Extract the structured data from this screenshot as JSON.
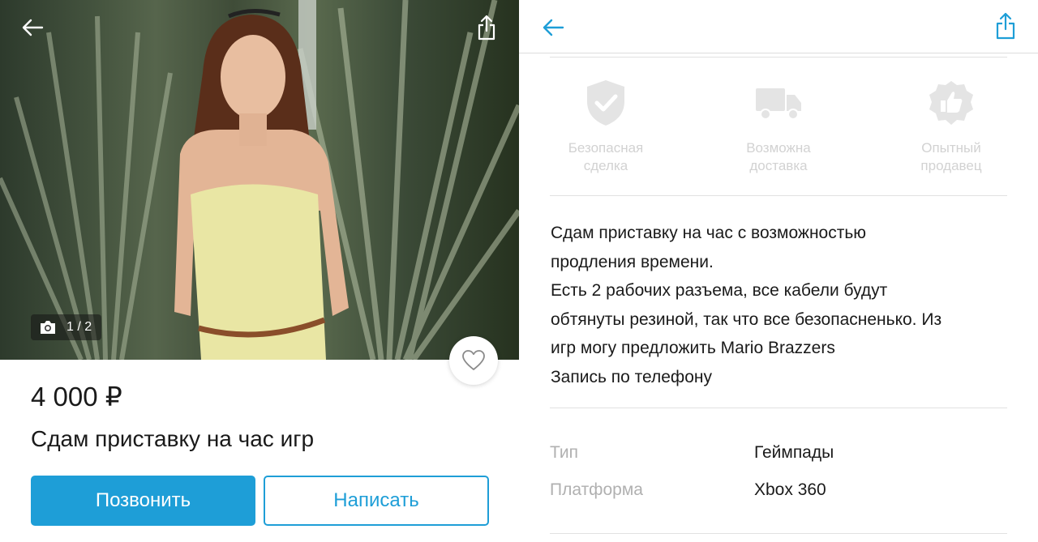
{
  "listing": {
    "photo_counter": "1 / 2",
    "price": "4 000 ₽",
    "title": "Сдам приставку на час игр",
    "call_button": "Позвонить",
    "write_button": "Написать"
  },
  "features": [
    {
      "icon": "shield-check-icon",
      "label_line1": "Безопасная",
      "label_line2": "сделка"
    },
    {
      "icon": "truck-icon",
      "label_line1": "Возможна",
      "label_line2": "доставка"
    },
    {
      "icon": "thumbs-up-badge-icon",
      "label_line1": "Опытный",
      "label_line2": "продавец"
    }
  ],
  "description": [
    "Сдам приставку на час с возможностью",
    "продления времени.",
    "Есть 2 рабочих разъема, все кабели будут",
    "обтянуты резиной, так что все безопасненько. Из",
    "игр могу предложить Mario Brazzers",
    "Запись по телефону"
  ],
  "properties": [
    {
      "key": "Тип",
      "value": "Геймпады"
    },
    {
      "key": "Платформа",
      "value": "Xbox 360"
    }
  ],
  "colors": {
    "accent": "#1e9ed7",
    "muted_text": "#b0b0b0",
    "feature_icon": "#e0e0e0"
  }
}
